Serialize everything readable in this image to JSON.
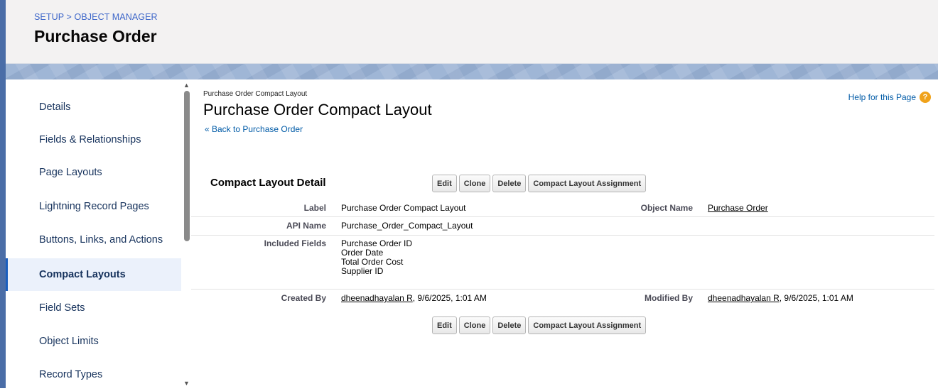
{
  "header": {
    "breadcrumb_setup": "SETUP",
    "breadcrumb_sep": ">",
    "breadcrumb_object_manager": "OBJECT MANAGER",
    "title": "Purchase Order"
  },
  "sidebar": {
    "items": [
      {
        "label": "Details"
      },
      {
        "label": "Fields & Relationships"
      },
      {
        "label": "Page Layouts"
      },
      {
        "label": "Lightning Record Pages"
      },
      {
        "label": "Buttons, Links, and Actions"
      },
      {
        "label": "Compact Layouts",
        "active": true
      },
      {
        "label": "Field Sets"
      },
      {
        "label": "Object Limits"
      },
      {
        "label": "Record Types"
      }
    ]
  },
  "main": {
    "small_title": "Purchase Order Compact Layout",
    "title": "Purchase Order Compact Layout",
    "back_link": "« Back to Purchase Order",
    "help_link": "Help for this Page",
    "section_title": "Compact Layout Detail",
    "buttons": {
      "edit": "Edit",
      "clone": "Clone",
      "delete": "Delete",
      "assignment": "Compact Layout Assignment"
    },
    "fields": {
      "label_label": "Label",
      "label_value": "Purchase Order Compact Layout",
      "object_name_label": "Object Name",
      "object_name_value": "Purchase Order",
      "api_name_label": "API Name",
      "api_name_value": "Purchase_Order_Compact_Layout",
      "included_fields_label": "Included Fields",
      "included_fields": [
        "Purchase Order ID",
        "Order Date",
        "Total Order Cost",
        "Supplier ID"
      ],
      "created_by_label": "Created By",
      "created_by_user": "dheenadhayalan R",
      "created_by_date": ", 9/6/2025, 1:01 AM",
      "modified_by_label": "Modified By",
      "modified_by_user": "dheenadhayalan R",
      "modified_by_date": ", 9/6/2025, 1:01 AM"
    }
  },
  "colors": {
    "link": "#015ba7",
    "active_bg": "#ebf1fb",
    "active_border": "#1b5fbf"
  }
}
